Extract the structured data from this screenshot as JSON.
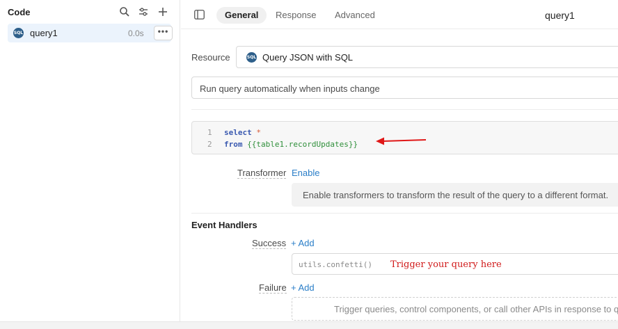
{
  "sidebar": {
    "title": "Code",
    "icons": [
      "search-icon",
      "filter-icon",
      "plus-icon"
    ],
    "query": {
      "badge": "SQL",
      "name": "query1",
      "time": "0.0s",
      "more": "•••"
    }
  },
  "tabs": [
    {
      "label": "General",
      "active": true
    },
    {
      "label": "Response",
      "active": false
    },
    {
      "label": "Advanced",
      "active": false
    }
  ],
  "query_title": "query1",
  "resource": {
    "label": "Resource",
    "badge": "SQL",
    "value": "Query JSON with SQL"
  },
  "run_mode": "Run query automatically when inputs change",
  "code": {
    "line_numbers": [
      "1",
      "2"
    ],
    "line1_kw": "select",
    "line1_rest": "*",
    "line2_kw": "from",
    "line2_rest": "{{table1.recordUpdates}}"
  },
  "transformer": {
    "label": "Transformer",
    "link": "Enable",
    "info": "Enable transformers to transform the result of the query to a different format."
  },
  "event_handlers": {
    "title": "Event Handlers",
    "success_label": "Success",
    "success_add": "+ Add",
    "success_code": "utils.confetti()",
    "annotation": "Trigger your query here",
    "failure_label": "Failure",
    "failure_add": "+ Add",
    "failure_hint": "Trigger queries, control components, or call other APIs in response to qu"
  },
  "colors": {
    "accent": "#2a7ec8",
    "selected_row": "#ebf3fc",
    "annotation": "#d01818"
  }
}
